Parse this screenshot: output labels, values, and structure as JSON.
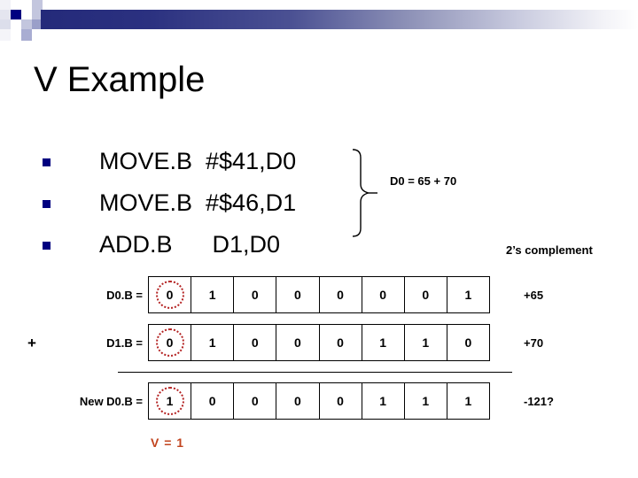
{
  "slide": {
    "title": "V Example",
    "decor": {
      "navy": "#000080",
      "bar_start": "#242a7a",
      "bar_end": "#ffffff"
    }
  },
  "instructions": {
    "bullet_icon": "square-bullet-icon",
    "items": [
      {
        "text": "MOVE.B  #$41,D0"
      },
      {
        "text": "MOVE.B  #$46,D1"
      },
      {
        "text": "ADD.B      D1,D0"
      }
    ]
  },
  "annotations": {
    "brace_icon": "curly-brace-icon",
    "d0_sum": "D0 = 65 + 70",
    "twos_complement": "2’s complement",
    "plus_operator": "+",
    "v_flag": "V = 1",
    "v_flag_color": "#c1441e"
  },
  "bit_table": {
    "msb_highlight_color": "#b32121",
    "rows": [
      {
        "label": "D0.B =",
        "bits": [
          "0",
          "1",
          "0",
          "0",
          "0",
          "0",
          "0",
          "1"
        ],
        "note": "+65"
      },
      {
        "label": "D1.B =",
        "bits": [
          "0",
          "1",
          "0",
          "0",
          "0",
          "1",
          "1",
          "0"
        ],
        "note": "+70"
      },
      {
        "label": "New D0.B =",
        "bits": [
          "1",
          "0",
          "0",
          "0",
          "0",
          "1",
          "1",
          "1"
        ],
        "note": "-121?"
      }
    ]
  }
}
